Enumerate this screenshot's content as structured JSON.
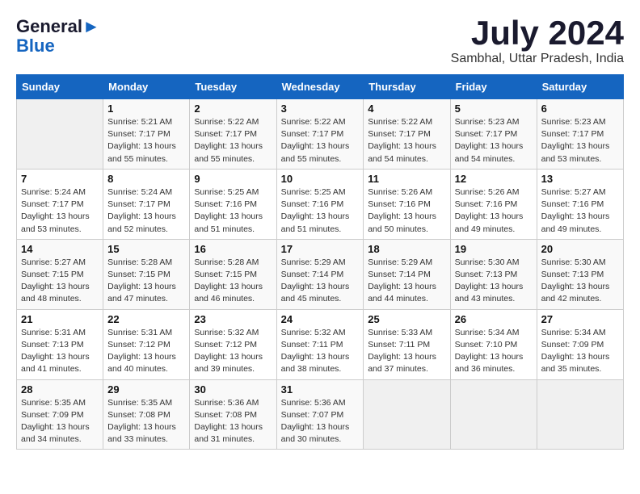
{
  "logo": {
    "general": "General",
    "blue": "Blue"
  },
  "title": {
    "month_year": "July 2024",
    "location": "Sambhal, Uttar Pradesh, India"
  },
  "headers": [
    "Sunday",
    "Monday",
    "Tuesday",
    "Wednesday",
    "Thursday",
    "Friday",
    "Saturday"
  ],
  "weeks": [
    [
      {
        "day": "",
        "sunrise": "",
        "sunset": "",
        "daylight": ""
      },
      {
        "day": "1",
        "sunrise": "Sunrise: 5:21 AM",
        "sunset": "Sunset: 7:17 PM",
        "daylight": "Daylight: 13 hours and 55 minutes."
      },
      {
        "day": "2",
        "sunrise": "Sunrise: 5:22 AM",
        "sunset": "Sunset: 7:17 PM",
        "daylight": "Daylight: 13 hours and 55 minutes."
      },
      {
        "day": "3",
        "sunrise": "Sunrise: 5:22 AM",
        "sunset": "Sunset: 7:17 PM",
        "daylight": "Daylight: 13 hours and 55 minutes."
      },
      {
        "day": "4",
        "sunrise": "Sunrise: 5:22 AM",
        "sunset": "Sunset: 7:17 PM",
        "daylight": "Daylight: 13 hours and 54 minutes."
      },
      {
        "day": "5",
        "sunrise": "Sunrise: 5:23 AM",
        "sunset": "Sunset: 7:17 PM",
        "daylight": "Daylight: 13 hours and 54 minutes."
      },
      {
        "day": "6",
        "sunrise": "Sunrise: 5:23 AM",
        "sunset": "Sunset: 7:17 PM",
        "daylight": "Daylight: 13 hours and 53 minutes."
      }
    ],
    [
      {
        "day": "7",
        "sunrise": "Sunrise: 5:24 AM",
        "sunset": "Sunset: 7:17 PM",
        "daylight": "Daylight: 13 hours and 53 minutes."
      },
      {
        "day": "8",
        "sunrise": "Sunrise: 5:24 AM",
        "sunset": "Sunset: 7:17 PM",
        "daylight": "Daylight: 13 hours and 52 minutes."
      },
      {
        "day": "9",
        "sunrise": "Sunrise: 5:25 AM",
        "sunset": "Sunset: 7:16 PM",
        "daylight": "Daylight: 13 hours and 51 minutes."
      },
      {
        "day": "10",
        "sunrise": "Sunrise: 5:25 AM",
        "sunset": "Sunset: 7:16 PM",
        "daylight": "Daylight: 13 hours and 51 minutes."
      },
      {
        "day": "11",
        "sunrise": "Sunrise: 5:26 AM",
        "sunset": "Sunset: 7:16 PM",
        "daylight": "Daylight: 13 hours and 50 minutes."
      },
      {
        "day": "12",
        "sunrise": "Sunrise: 5:26 AM",
        "sunset": "Sunset: 7:16 PM",
        "daylight": "Daylight: 13 hours and 49 minutes."
      },
      {
        "day": "13",
        "sunrise": "Sunrise: 5:27 AM",
        "sunset": "Sunset: 7:16 PM",
        "daylight": "Daylight: 13 hours and 49 minutes."
      }
    ],
    [
      {
        "day": "14",
        "sunrise": "Sunrise: 5:27 AM",
        "sunset": "Sunset: 7:15 PM",
        "daylight": "Daylight: 13 hours and 48 minutes."
      },
      {
        "day": "15",
        "sunrise": "Sunrise: 5:28 AM",
        "sunset": "Sunset: 7:15 PM",
        "daylight": "Daylight: 13 hours and 47 minutes."
      },
      {
        "day": "16",
        "sunrise": "Sunrise: 5:28 AM",
        "sunset": "Sunset: 7:15 PM",
        "daylight": "Daylight: 13 hours and 46 minutes."
      },
      {
        "day": "17",
        "sunrise": "Sunrise: 5:29 AM",
        "sunset": "Sunset: 7:14 PM",
        "daylight": "Daylight: 13 hours and 45 minutes."
      },
      {
        "day": "18",
        "sunrise": "Sunrise: 5:29 AM",
        "sunset": "Sunset: 7:14 PM",
        "daylight": "Daylight: 13 hours and 44 minutes."
      },
      {
        "day": "19",
        "sunrise": "Sunrise: 5:30 AM",
        "sunset": "Sunset: 7:13 PM",
        "daylight": "Daylight: 13 hours and 43 minutes."
      },
      {
        "day": "20",
        "sunrise": "Sunrise: 5:30 AM",
        "sunset": "Sunset: 7:13 PM",
        "daylight": "Daylight: 13 hours and 42 minutes."
      }
    ],
    [
      {
        "day": "21",
        "sunrise": "Sunrise: 5:31 AM",
        "sunset": "Sunset: 7:13 PM",
        "daylight": "Daylight: 13 hours and 41 minutes."
      },
      {
        "day": "22",
        "sunrise": "Sunrise: 5:31 AM",
        "sunset": "Sunset: 7:12 PM",
        "daylight": "Daylight: 13 hours and 40 minutes."
      },
      {
        "day": "23",
        "sunrise": "Sunrise: 5:32 AM",
        "sunset": "Sunset: 7:12 PM",
        "daylight": "Daylight: 13 hours and 39 minutes."
      },
      {
        "day": "24",
        "sunrise": "Sunrise: 5:32 AM",
        "sunset": "Sunset: 7:11 PM",
        "daylight": "Daylight: 13 hours and 38 minutes."
      },
      {
        "day": "25",
        "sunrise": "Sunrise: 5:33 AM",
        "sunset": "Sunset: 7:11 PM",
        "daylight": "Daylight: 13 hours and 37 minutes."
      },
      {
        "day": "26",
        "sunrise": "Sunrise: 5:34 AM",
        "sunset": "Sunset: 7:10 PM",
        "daylight": "Daylight: 13 hours and 36 minutes."
      },
      {
        "day": "27",
        "sunrise": "Sunrise: 5:34 AM",
        "sunset": "Sunset: 7:09 PM",
        "daylight": "Daylight: 13 hours and 35 minutes."
      }
    ],
    [
      {
        "day": "28",
        "sunrise": "Sunrise: 5:35 AM",
        "sunset": "Sunset: 7:09 PM",
        "daylight": "Daylight: 13 hours and 34 minutes."
      },
      {
        "day": "29",
        "sunrise": "Sunrise: 5:35 AM",
        "sunset": "Sunset: 7:08 PM",
        "daylight": "Daylight: 13 hours and 33 minutes."
      },
      {
        "day": "30",
        "sunrise": "Sunrise: 5:36 AM",
        "sunset": "Sunset: 7:08 PM",
        "daylight": "Daylight: 13 hours and 31 minutes."
      },
      {
        "day": "31",
        "sunrise": "Sunrise: 5:36 AM",
        "sunset": "Sunset: 7:07 PM",
        "daylight": "Daylight: 13 hours and 30 minutes."
      },
      {
        "day": "",
        "sunrise": "",
        "sunset": "",
        "daylight": ""
      },
      {
        "day": "",
        "sunrise": "",
        "sunset": "",
        "daylight": ""
      },
      {
        "day": "",
        "sunrise": "",
        "sunset": "",
        "daylight": ""
      }
    ]
  ]
}
